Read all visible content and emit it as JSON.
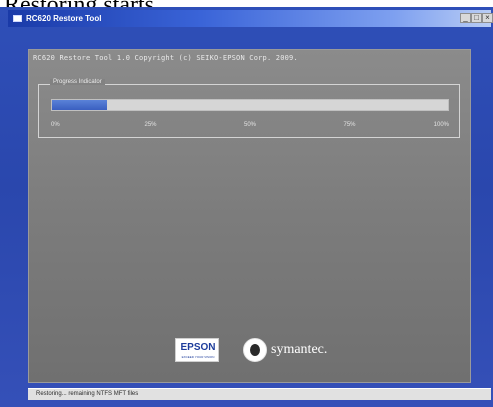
{
  "caption": "Restoring starts.",
  "window": {
    "title": "RC620 Restore Tool",
    "controls": {
      "minimize": "_",
      "maximize": "□",
      "close": "×"
    }
  },
  "header_text": "RC620 Restore Tool 1.0   Copyright (c) SEIKO-EPSON Corp. 2009.",
  "progress": {
    "group_title": "Progress Indicator",
    "value_fraction": 0.14,
    "ticks": [
      "0%",
      "25%",
      "50%",
      "75%",
      "100%"
    ],
    "fill_color": "#4a70cc"
  },
  "logos": {
    "epson": {
      "brand": "EPSON",
      "tagline": "EXCEED YOUR VISION"
    },
    "symantec": {
      "word": "symantec."
    }
  },
  "status": "Restoring... remaining NTFS MFT files"
}
